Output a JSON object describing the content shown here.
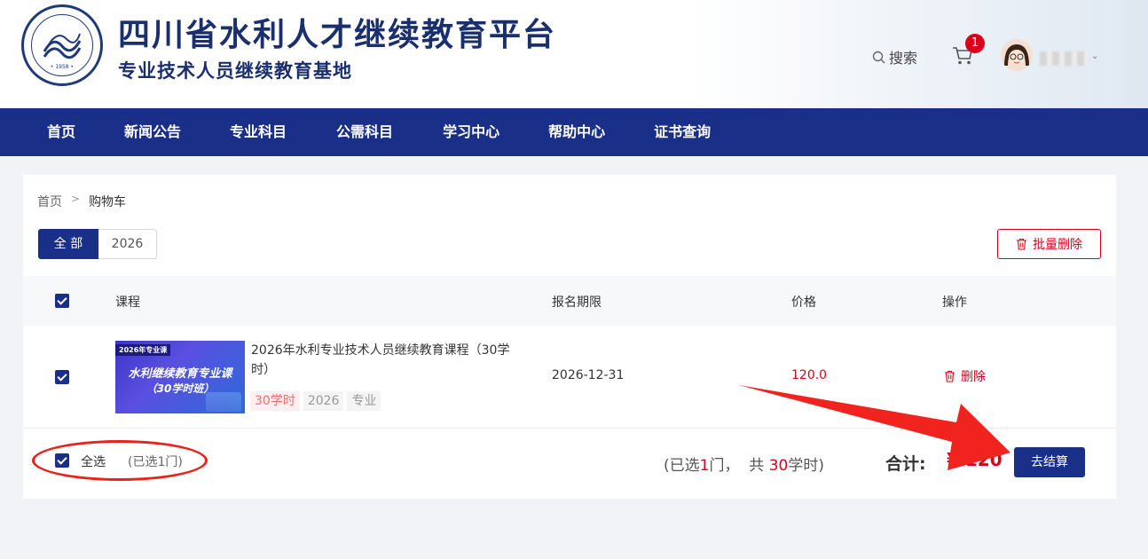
{
  "header": {
    "site_title": "四川省水利人才继续教育平台",
    "site_subtitle": "专业技术人员继续教育基地",
    "logo_year": "• 1958 •",
    "search_label": "搜索",
    "cart_count": "1",
    "user_caret": "⌄"
  },
  "nav": {
    "items": [
      {
        "label": "首页"
      },
      {
        "label": "新闻公告"
      },
      {
        "label": "专业科目"
      },
      {
        "label": "公需科目"
      },
      {
        "label": "学习中心"
      },
      {
        "label": "帮助中心"
      },
      {
        "label": "证书查询"
      }
    ]
  },
  "breadcrumb": {
    "home": "首页",
    "sep": ">",
    "current": "购物车"
  },
  "tabs": [
    {
      "label": "全 部"
    },
    {
      "label": "2026"
    }
  ],
  "batch_delete_label": "批量删除",
  "table": {
    "headers": {
      "course": "课程",
      "period": "报名期限",
      "price": "价格",
      "action": "操作"
    },
    "rows": [
      {
        "thumb_tag": "2026年专业课",
        "thumb_line1": "水利继续教育专业课",
        "thumb_line2": "（30学时班）",
        "title": "2026年水利专业技术人员继续教育课程（30学时）",
        "tags": [
          "30学时",
          "2026",
          "专业"
        ],
        "deadline": "2026-12-31",
        "price": "120.0",
        "delete_label": "删除"
      }
    ]
  },
  "footer": {
    "select_all_label": "全选",
    "selected_text": "(已选1门)",
    "summary_prefix": "(已选",
    "summary_count": "1",
    "summary_mid": "门，  共 ",
    "summary_hours": "30",
    "summary_suffix": "学时)",
    "total_label": "合计:",
    "total_value": "¥ 120",
    "checkout_label": "去结算"
  },
  "colors": {
    "brand": "#1a2f87",
    "accent_red": "#d9001b",
    "annotation_red": "#e8231b"
  }
}
